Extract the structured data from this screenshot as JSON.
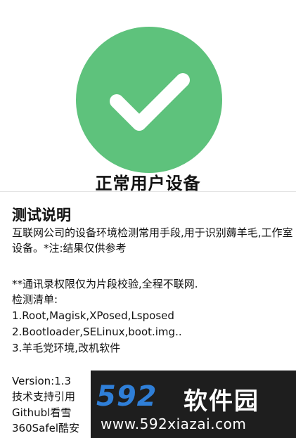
{
  "colors": {
    "success": "#5ec27c",
    "watermark_bg": "#1e1e1e",
    "watermark_accent": "#2f7fd8"
  },
  "status": {
    "icon": "checkmark-icon",
    "title": "正常用户设备"
  },
  "section": {
    "title": "测试说明",
    "description": "互联网公司的设备环境检测常用手段,用于识别薅羊毛,工作室设备。*注:结果仅供参考",
    "notice": "**通讯录权限仅为片段校验,全程不联网.",
    "list_header": "检测清单:",
    "items": [
      "1.Root,Magisk,XPosed,Lsposed",
      "2.Bootloader,SELinux,boot.img..",
      "3.羊毛党环境,改机软件"
    ],
    "footer": [
      "Version:1.3",
      "技术支持引用",
      "Githubl看雪",
      "360Safel酷安"
    ]
  },
  "watermark": {
    "logo": "592",
    "name": "软件园",
    "url": "www.592xiazai.com"
  }
}
